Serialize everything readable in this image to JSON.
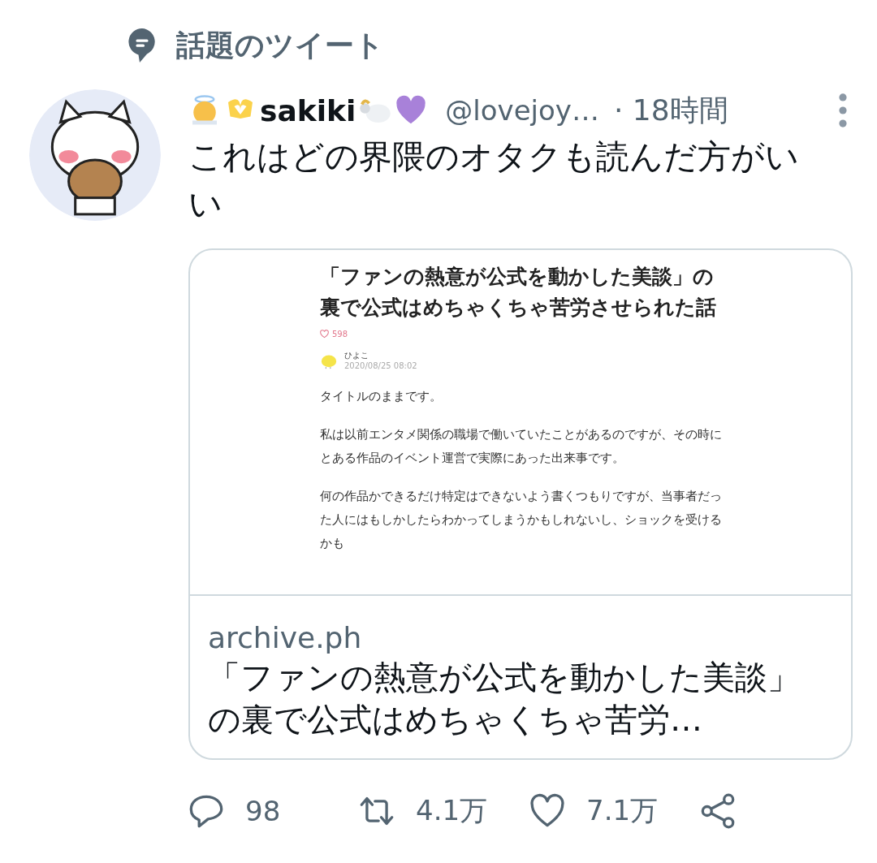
{
  "section": {
    "title": "話題のツイート"
  },
  "tweet": {
    "name": "sakiki",
    "handle": "@lovejoy…",
    "time": "· 18時間",
    "text": "これはどの界隈のオタクも読んだ方がいい",
    "card": {
      "article": {
        "title": "「ファンの熱意が公式を動かした美談」の裏で公式はめちゃくちゃ苦労させられた話",
        "likes": "598",
        "author": "ひよこ",
        "date": "2020/08/25 08:02",
        "paragraphs": [
          "タイトルのままです。",
          "私は以前エンタメ関係の職場で働いていたことがあるのですが、その時にとある作品のイベント運営で実際にあった出来事です。",
          "何の作品かできるだけ特定はできないよう書くつもりですが、当事者だった人にはもしかしたらわかってしまうかもしれないし、ショックを受けるかも"
        ]
      },
      "domain": "archive.ph",
      "title": "「ファンの熱意が公式を動かした美談」の裏で公式はめちゃくちゃ苦労…"
    },
    "actions": [
      {
        "kind": "reply",
        "count": "98"
      },
      {
        "kind": "retweet",
        "count": "4.1万"
      },
      {
        "kind": "like",
        "count": "7.1万"
      },
      {
        "kind": "share"
      }
    ]
  }
}
